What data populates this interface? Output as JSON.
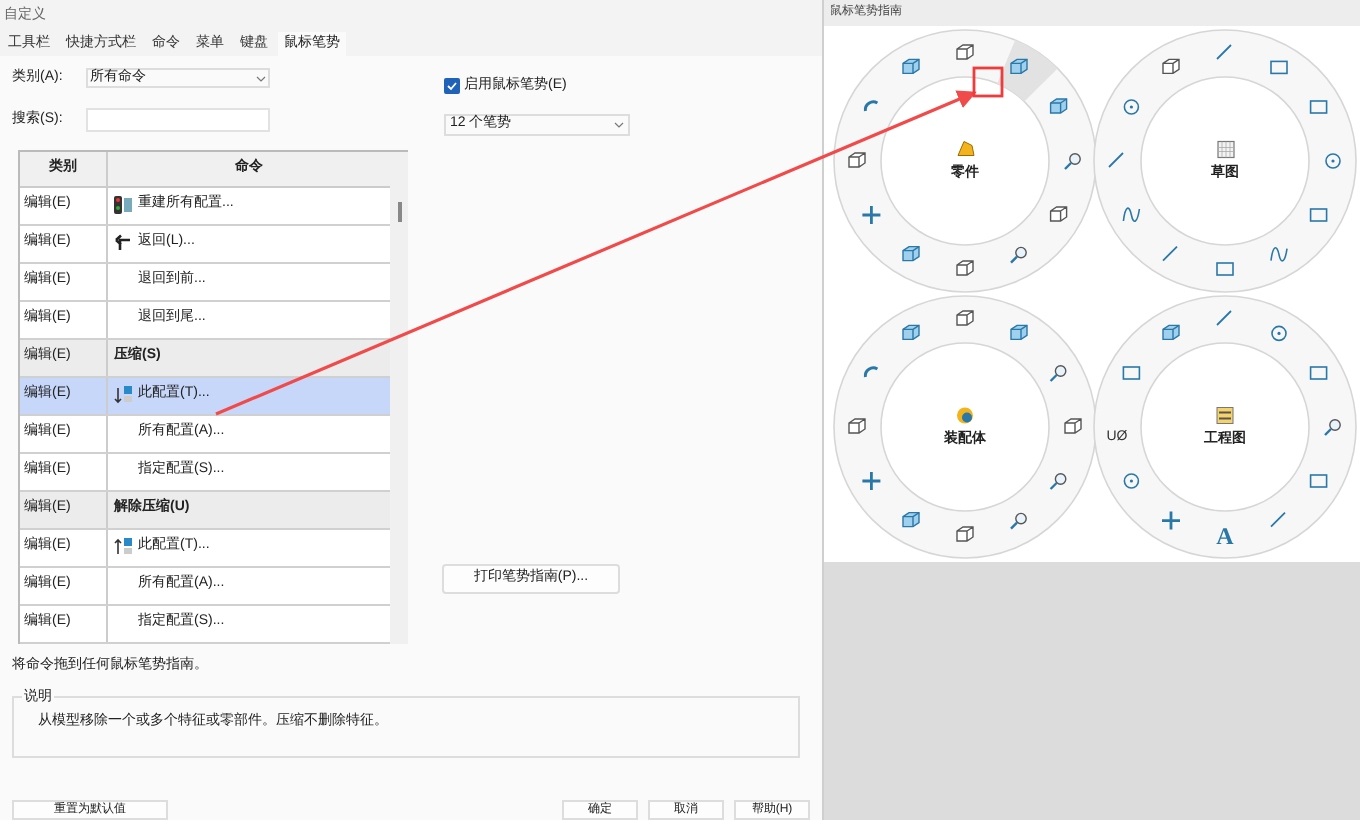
{
  "dialog": {
    "title": "自定义",
    "tabs": [
      {
        "label": "工具栏",
        "selected": false
      },
      {
        "label": "快捷方式栏",
        "selected": false
      },
      {
        "label": "命令",
        "selected": false
      },
      {
        "label": "菜单",
        "selected": false
      },
      {
        "label": "键盘",
        "selected": false
      },
      {
        "label": "鼠标笔势",
        "selected": true
      }
    ],
    "category_label": "类别(A):",
    "category_value": "所有命令",
    "search_label": "搜索(S):",
    "enable_gestures": {
      "label": "启用鼠标笔势(E)",
      "checked": true
    },
    "gesture_count": "12 个笔势",
    "table": {
      "columns": [
        "类别",
        "命令"
      ],
      "rows": [
        {
          "kind": "rebuild",
          "category": "编辑(E)",
          "command": "重建所有配置...",
          "selected": false
        },
        {
          "kind": "undo",
          "category": "编辑(E)",
          "command": "返回(L)...",
          "selected": false
        },
        {
          "kind": "command",
          "category": "编辑(E)",
          "command": "退回到前...",
          "selected": false
        },
        {
          "kind": "command",
          "category": "编辑(E)",
          "command": "退回到尾...",
          "selected": false
        },
        {
          "kind": "group",
          "category": "编辑(E)",
          "command": "压缩(S)",
          "selected": false
        },
        {
          "kind": "suppress",
          "category": "编辑(E)",
          "command": "此配置(T)...",
          "selected": true
        },
        {
          "kind": "command",
          "category": "编辑(E)",
          "command": "所有配置(A)...",
          "selected": false
        },
        {
          "kind": "command",
          "category": "编辑(E)",
          "command": "指定配置(S)...",
          "selected": false
        },
        {
          "kind": "group",
          "category": "编辑(E)",
          "command": "解除压缩(U)",
          "selected": false
        },
        {
          "kind": "unsuppress",
          "category": "编辑(E)",
          "command": "此配置(T)...",
          "selected": false
        },
        {
          "kind": "command",
          "category": "编辑(E)",
          "command": "所有配置(A)...",
          "selected": false
        },
        {
          "kind": "command",
          "category": "编辑(E)",
          "command": "指定配置(S)...",
          "selected": false
        }
      ]
    },
    "print_button": "打印笔势指南(P)...",
    "hint": "将命令拖到任何鼠标笔势指南。",
    "description": {
      "title": "说明",
      "text": "从模型移除一个或多个特征或零部件。压缩不删除特征。"
    },
    "buttons": [
      {
        "label": "重置为默认值"
      },
      {
        "label": "确定"
      },
      {
        "label": "取消"
      },
      {
        "label": "帮助(H)"
      }
    ]
  },
  "guide": {
    "title": "鼠标笔势指南",
    "wheels": [
      {
        "kind": "part",
        "label": "零件"
      },
      {
        "kind": "sketch",
        "label": "草图"
      },
      {
        "kind": "assembly",
        "label": "装配体"
      },
      {
        "kind": "drawing",
        "label": "工程图",
        "glyphs": [
          "UØ",
          "A"
        ]
      }
    ]
  }
}
